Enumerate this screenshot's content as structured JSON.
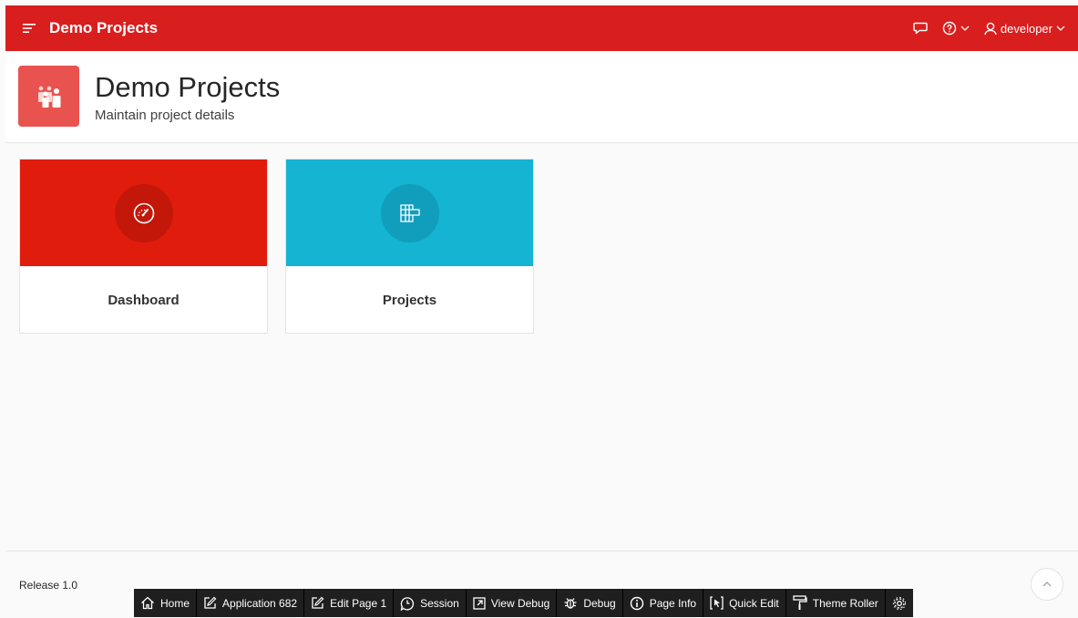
{
  "header": {
    "app_title": "Demo Projects",
    "user_label": "developer",
    "icons": {
      "menu": "hamburger-icon",
      "feedback": "chat-bubble-icon",
      "help": "help-circle-icon",
      "user": "user-icon"
    },
    "bg_color": "#d91e1e"
  },
  "hero": {
    "title": "Demo Projects",
    "subtitle": "Maintain project details",
    "icon": "people-icon",
    "icon_bg": "#e8534f"
  },
  "cards": [
    {
      "title": "Dashboard",
      "icon": "speedometer-icon",
      "color": "#e01c0c"
    },
    {
      "title": "Projects",
      "icon": "grid-icon",
      "color": "#14b4d2"
    }
  ],
  "footer": {
    "release": "Release 1.0"
  },
  "dev_toolbar": {
    "home": "Home",
    "application": "Application 682",
    "edit_page": "Edit Page 1",
    "session": "Session",
    "view_debug": "View Debug",
    "debug": "Debug",
    "page_info": "Page Info",
    "quick_edit": "Quick Edit",
    "theme_roller": "Theme Roller"
  }
}
